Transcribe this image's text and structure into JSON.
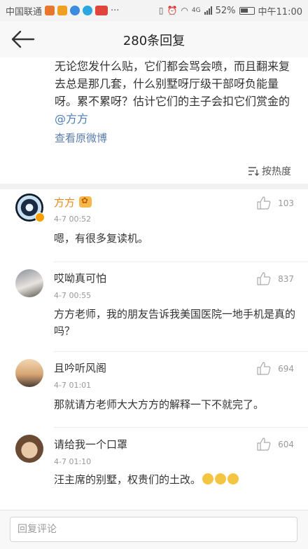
{
  "status_bar": {
    "carrier": "中国联通",
    "dots": "···",
    "battery": "52%",
    "time": "中午11:00",
    "net": "4G"
  },
  "nav": {
    "title": "280条回复"
  },
  "post": {
    "text": "无论您发什么贴，它们都会骂会喷，而且翻来复去总是那几套，什么别墅呀厅级干部呀负能量呀。累不累呀？估计它们的主子会扣它们赏金的",
    "mention": "@方方",
    "view_original": "查看原微博",
    "sort_label": "按热度"
  },
  "comments": [
    {
      "name": "方方",
      "time": "4-7 00:52",
      "text": "嗯，有很多复读机。",
      "likes": "103"
    },
    {
      "name": "哎呦真可怕",
      "time": "4-7 00:55",
      "text": "方方老师，我的朋友告诉我美国医院一地手机是真的吗？",
      "likes": "837"
    },
    {
      "name": "且吟听风阁",
      "time": "4-7 01:01",
      "text": "那就请方老师大大方方的解释一下不就完了。",
      "likes": "694"
    },
    {
      "name": "请给我一个口罩",
      "time": "4-7 01:10",
      "text": "汪主席的别墅，权贵们的土改。",
      "likes": "604"
    }
  ],
  "reply": {
    "placeholder": "回复评论"
  },
  "colors": {
    "accent_link": "#5a7db0",
    "vip_name": "#e88a1a"
  }
}
